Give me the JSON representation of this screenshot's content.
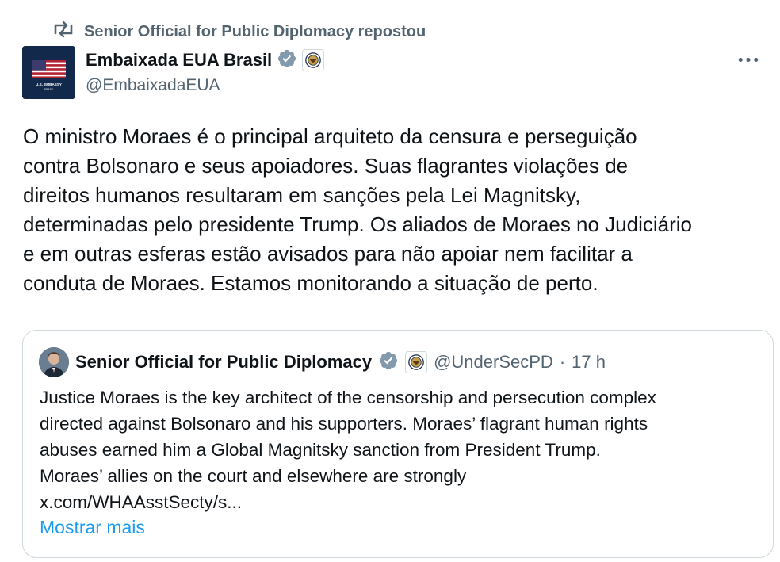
{
  "repost": {
    "icon": "repost-icon",
    "text": "Senior Official for Public Diplomacy repostou"
  },
  "author": {
    "avatar": "us-embassy-logo",
    "avatar_text": "U.S. EMBASSY",
    "avatar_subtext": "BRASIL",
    "name": "Embaixada EUA Brasil",
    "verified_icon": "verified-badge-icon",
    "affiliate_icon": "state-department-seal-icon",
    "handle": "@EmbaixadaEUA"
  },
  "more_icon": "more-options-icon",
  "tweet": {
    "lines": [
      "O ministro Moraes é o principal arquiteto da censura e perseguição",
      "contra Bolsonaro e seus apoiadores. Suas flagrantes violações de",
      "direitos humanos resultaram em sanções pela Lei Magnitsky,",
      "determinadas pelo presidente Trump. Os aliados de Moraes no Judiciário",
      "e em outras esferas estão avisados para não apoiar nem facilitar a",
      "conduta de Moraes. Estamos monitorando a situação de perto."
    ]
  },
  "quote": {
    "name": "Senior Official for Public Diplomacy",
    "handle": "@UnderSecPD",
    "separator": "·",
    "time": "17 h",
    "lines": [
      "Justice Moraes is the key architect of the censorship and persecution complex",
      "directed against Bolsonaro and his supporters. Moraes’ flagrant human rights",
      "abuses earned him a Global Magnitsky sanction from President Trump.",
      "Moraes’ allies on the court and elsewhere are strongly"
    ],
    "link": "x.com/WHAAsstSecty/s...",
    "show_more": "Mostrar mais"
  },
  "colors": {
    "accent": "#1d9bf0",
    "secondary_text": "#536471",
    "border": "#cfd9de",
    "primary_text": "#0f1419"
  }
}
